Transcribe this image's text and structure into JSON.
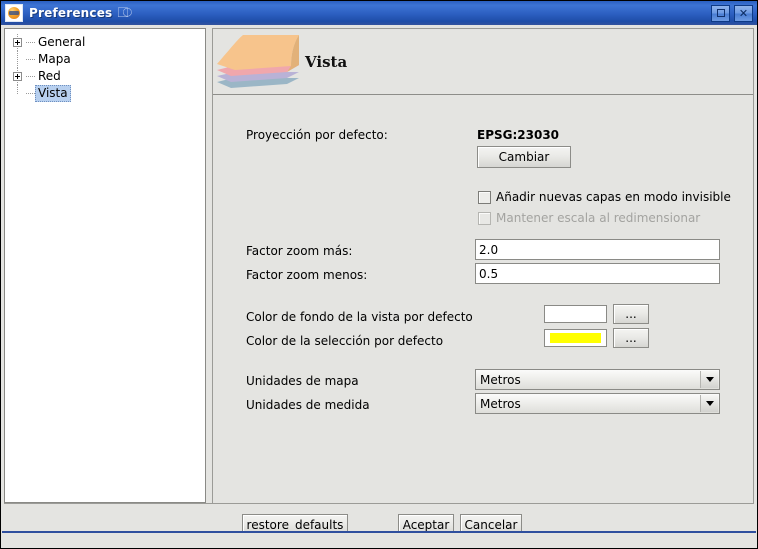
{
  "window": {
    "title": "Preferences",
    "app_icon": "gvsig-logo-icon",
    "title_decor_icon": "swirl-icon",
    "controls": {
      "maximize": "□",
      "close": "✕"
    }
  },
  "sidebar": {
    "items": [
      {
        "label": "General",
        "expandable": true,
        "selected": false
      },
      {
        "label": "Mapa",
        "expandable": false,
        "selected": false
      },
      {
        "label": "Red",
        "expandable": true,
        "selected": false
      },
      {
        "label": "Vista",
        "expandable": false,
        "selected": true
      }
    ]
  },
  "panel": {
    "title": "Vista",
    "icon": "layer-stack-icon",
    "projection": {
      "label": "Proyección por defecto:",
      "value": "EPSG:23030",
      "change_button": "Cambiar"
    },
    "checkboxes": [
      {
        "label": "Añadir nuevas capas en modo invisible",
        "checked": false,
        "enabled": true
      },
      {
        "label": "Mantener escala al redimensionar",
        "checked": false,
        "enabled": false
      }
    ],
    "zoom_fields": [
      {
        "label": "Factor zoom más:",
        "value": "2.0"
      },
      {
        "label": "Factor zoom menos:",
        "value": "0.5"
      }
    ],
    "colors": [
      {
        "label": "Color de fondo de la vista por defecto",
        "value": "#ffffff",
        "button": "..."
      },
      {
        "label": "Color de la selección por defecto",
        "value": "#ffff00",
        "button": "..."
      }
    ],
    "units": [
      {
        "label": "Unidades de mapa",
        "value": "Metros"
      },
      {
        "label": "Unidades de medida",
        "value": "Metros"
      }
    ]
  },
  "footer": {
    "restore_defaults": "restore_defaults",
    "accept": "Aceptar",
    "cancel": "Cancelar"
  },
  "theme": {
    "titlebar_blue": "#2d60c2",
    "panel_grey": "#e4e4e1",
    "selection_blue": "#b8d0ef",
    "accent_yellow": "#ffff00"
  }
}
